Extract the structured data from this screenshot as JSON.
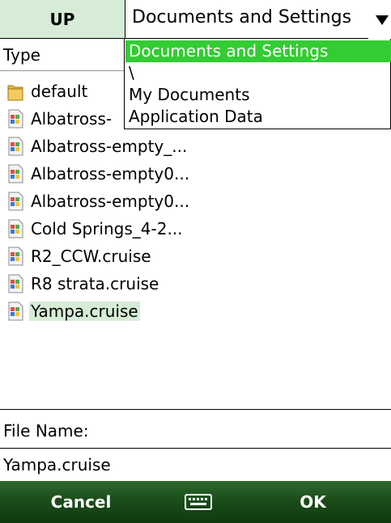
{
  "toolbar": {
    "up_label": "UP",
    "path_value": "Documents and Settings"
  },
  "dropdown": {
    "options": [
      "Documents and Settings",
      "\\",
      "My Documents",
      "Application Data"
    ],
    "selected_index": 0
  },
  "list": {
    "type_header": "Type",
    "items": [
      {
        "label": "default",
        "icon": "folder-icon"
      },
      {
        "label": "Albatross-",
        "icon": "cruise-file-icon"
      },
      {
        "label": "Albatross-empty_...",
        "icon": "cruise-file-icon"
      },
      {
        "label": "Albatross-empty0...",
        "icon": "cruise-file-icon"
      },
      {
        "label": "Albatross-empty0...",
        "icon": "cruise-file-icon"
      },
      {
        "label": "Cold Springs_4-2...",
        "icon": "cruise-file-icon"
      },
      {
        "label": "R2_CCW.cruise",
        "icon": "cruise-file-icon"
      },
      {
        "label": "R8 strata.cruise",
        "icon": "cruise-file-icon"
      },
      {
        "label": "Yampa.cruise",
        "icon": "cruise-file-icon",
        "selected": true
      }
    ]
  },
  "file_name": {
    "label": "File Name:",
    "value": "Yampa.cruise"
  },
  "softkeys": {
    "left": "Cancel",
    "right": "OK",
    "middle_icon": "keyboard-icon"
  },
  "colors": {
    "selection": "#d6ecd6",
    "dropdown_highlight": "#33cc33",
    "softkey_bar": "#1b4d1b"
  }
}
